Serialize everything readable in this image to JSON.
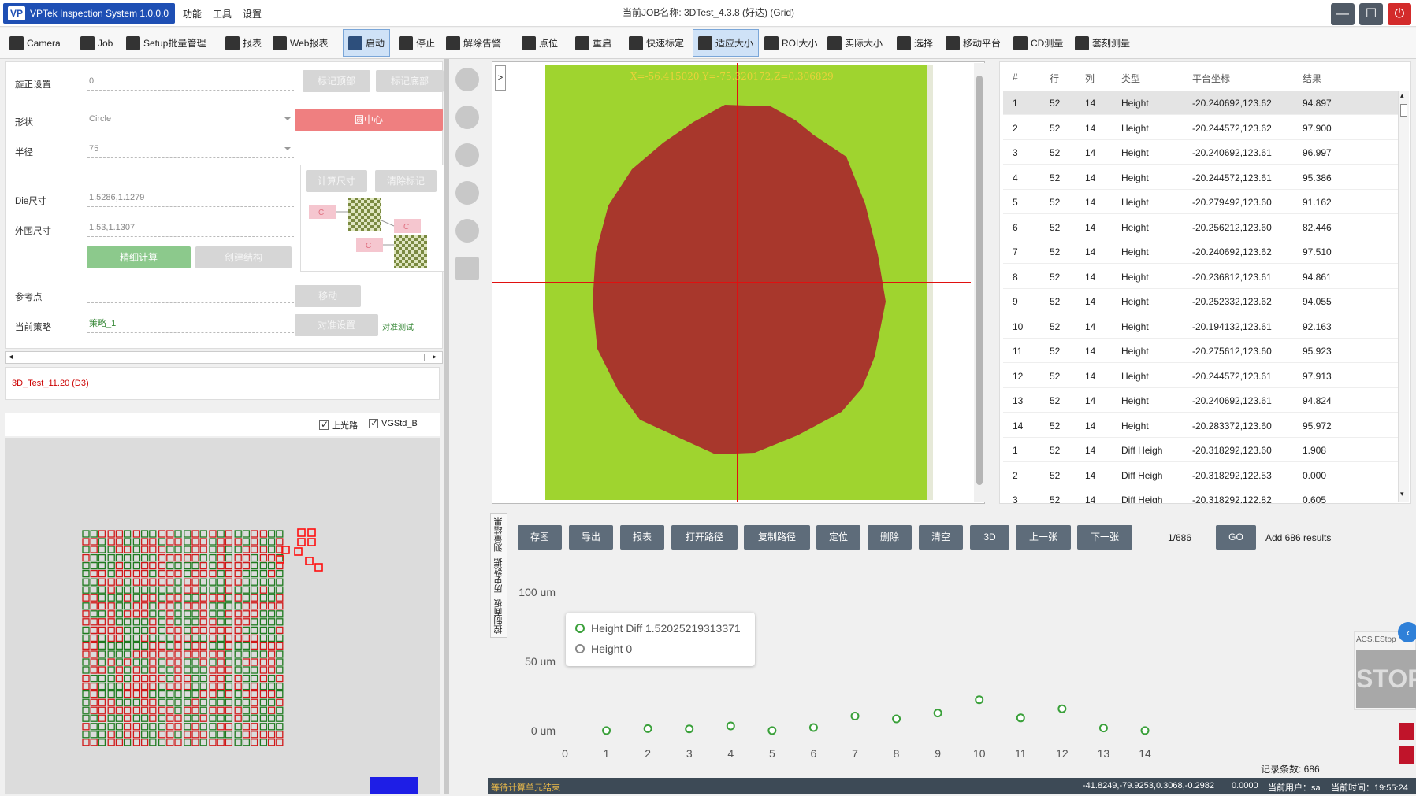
{
  "app": {
    "logo_mark": "VP",
    "title": "VPTek Inspection System 1.0.0.0",
    "menus": [
      "功能",
      "工具",
      "设置"
    ],
    "job_name": "当前JOB名称: 3DTest_4.3.8  (好达)  (Grid)"
  },
  "window": {
    "minimize": "—",
    "maximize": "☐",
    "close": "⏻"
  },
  "toolbar": [
    "Camera",
    "Job",
    "Setup批量管理",
    "报表",
    "Web报表",
    "启动",
    "停止",
    "解除告警",
    "点位",
    "重启",
    "快速标定",
    "适应大小",
    "ROI大小",
    "实际大小",
    "选择",
    "移动平台",
    "CD测量",
    "套刻测量"
  ],
  "left": {
    "rotation_label": "旋正设置",
    "rotation_value": "0",
    "mark_top": "标记顶部",
    "mark_bottom": "标记底部",
    "shape_label": "形状",
    "shape_value": "Circle",
    "circle_center": "圆中心",
    "radius_label": "半径",
    "radius_value": "75",
    "calc_size": "计算尺寸",
    "clear_mark": "清除标记",
    "die_label": "Die尺寸",
    "die_value": "1.5286,1.1279",
    "outer_label": "外围尺寸",
    "outer_value": "1.53,1.1307",
    "fine_calc": "精细计算",
    "create_struct": "创建结构",
    "ref_label": "参考点",
    "move": "移动",
    "strategy_label": "当前策略",
    "strategy_value": "策略_1",
    "align_setup": "对准设置",
    "align_test": "对准测试",
    "diagram_marks": [
      "C",
      "C",
      "C"
    ]
  },
  "job_link": "3D_Test_11.20 (D3)",
  "checks": [
    "上光路",
    "VGStd_B"
  ],
  "image": {
    "coord_text": "X=-56.415020,Y=-75.320172,Z=0.306829",
    "expand": ">"
  },
  "table": {
    "headers": [
      "#",
      "行",
      "列",
      "类型",
      "平台坐标",
      "结果"
    ],
    "rows": [
      [
        "1",
        "52",
        "14",
        "Height",
        "-20.240692,123.62",
        "94.897"
      ],
      [
        "2",
        "52",
        "14",
        "Height",
        "-20.244572,123.62",
        "97.900"
      ],
      [
        "3",
        "52",
        "14",
        "Height",
        "-20.240692,123.61",
        "96.997"
      ],
      [
        "4",
        "52",
        "14",
        "Height",
        "-20.244572,123.61",
        "95.386"
      ],
      [
        "5",
        "52",
        "14",
        "Height",
        "-20.279492,123.60",
        "91.162"
      ],
      [
        "6",
        "52",
        "14",
        "Height",
        "-20.256212,123.60",
        "82.446"
      ],
      [
        "7",
        "52",
        "14",
        "Height",
        "-20.240692,123.62",
        "97.510"
      ],
      [
        "8",
        "52",
        "14",
        "Height",
        "-20.236812,123.61",
        "94.861"
      ],
      [
        "9",
        "52",
        "14",
        "Height",
        "-20.252332,123.62",
        "94.055"
      ],
      [
        "10",
        "52",
        "14",
        "Height",
        "-20.194132,123.61",
        "92.163"
      ],
      [
        "11",
        "52",
        "14",
        "Height",
        "-20.275612,123.60",
        "95.923"
      ],
      [
        "12",
        "52",
        "14",
        "Height",
        "-20.244572,123.61",
        "97.913"
      ],
      [
        "13",
        "52",
        "14",
        "Height",
        "-20.240692,123.61",
        "94.824"
      ],
      [
        "14",
        "52",
        "14",
        "Height",
        "-20.283372,123.60",
        "95.972"
      ],
      [
        "1",
        "52",
        "14",
        "Diff Heigh",
        "-20.318292,123.60",
        "1.908"
      ],
      [
        "2",
        "52",
        "14",
        "Diff Heigh",
        "-20.318292,122.53",
        "0.000"
      ],
      [
        "3",
        "52",
        "14",
        "Diff Heigh",
        "-20.318292,122.82",
        "0.605"
      ]
    ]
  },
  "bottom": {
    "vtabs": [
      "控制面板",
      "历史数据",
      "测量结果"
    ],
    "buttons": [
      "存图",
      "导出",
      "报表",
      "打开路径",
      "复制路径",
      "定位",
      "删除",
      "清空",
      "3D",
      "上一张",
      "下一张"
    ],
    "page": "1/686",
    "go": "GO",
    "add_results": "Add 686 results",
    "record_count": "记录条数: 686",
    "estop_title": "ACS.EStop",
    "estop_label": "STOP",
    "nav_arrow": "‹"
  },
  "chart_data": {
    "type": "scatter",
    "x": [
      1,
      2,
      3,
      4,
      5,
      6,
      7,
      8,
      9,
      10,
      11,
      12,
      13,
      14
    ],
    "series": [
      {
        "name": "Height Diff",
        "values": [
          0.05,
          1.5,
          1.3,
          3.4,
          0.05,
          2.3,
          10.5,
          8.5,
          12.7,
          22.3,
          9.2,
          15.8,
          1.9,
          0.05
        ]
      }
    ],
    "ytick_labels": [
      "100 um",
      "50 um",
      "0 um"
    ],
    "yticks": [
      100,
      50,
      0
    ],
    "xticks": [
      0,
      1,
      2,
      3,
      4,
      5,
      6,
      7,
      8,
      9,
      10,
      11,
      12,
      13,
      14
    ],
    "ylim": [
      0,
      100
    ],
    "xlim": [
      0,
      14
    ],
    "legend": [
      {
        "label": "Height Diff 1.52025219313371",
        "state": "on"
      },
      {
        "label": "Height 0",
        "state": "off"
      }
    ],
    "color": "#3aa03a"
  },
  "status": {
    "message": "等待计算单元结束",
    "coords": "-41.8249,-79.9253,0.3068,-0.2982",
    "value": "0.0000",
    "user": "当前用户：sa",
    "time": "当前时间：19:55:24"
  },
  "colors": {
    "accent": "#1e4fb4",
    "status_bar": "#3d4a56",
    "image_bg": "#9fd42f",
    "image_spot": "#a8372c",
    "marker": "#3aa03a"
  }
}
